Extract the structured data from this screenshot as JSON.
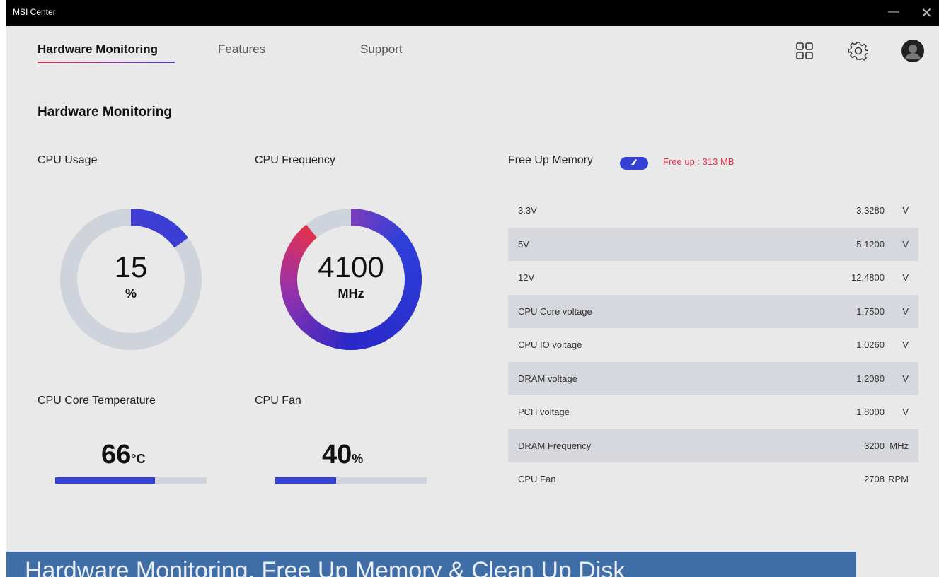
{
  "window": {
    "title": "MSI Center",
    "minimize_icon": "minimize-icon",
    "close_icon": "close-icon"
  },
  "nav": {
    "tabs": [
      {
        "label": "Hardware Monitoring",
        "active": true
      },
      {
        "label": "Features",
        "active": false
      },
      {
        "label": "Support",
        "active": false
      }
    ],
    "icons": [
      "grid-apps-icon",
      "gear-icon",
      "user-avatar-icon"
    ]
  },
  "page": {
    "title": "Hardware Monitoring"
  },
  "cpu_usage": {
    "label": "CPU Usage",
    "value": "15",
    "unit": "%",
    "fraction": 0.15
  },
  "cpu_frequency": {
    "label": "CPU Frequency",
    "value": "4100",
    "unit": "MHz",
    "fraction": 0.89
  },
  "cpu_temp": {
    "label": "CPU Core Temperature",
    "value": "66",
    "unit": "°C",
    "fraction": 0.66
  },
  "cpu_fan": {
    "label": "CPU Fan",
    "value": "40",
    "unit": "%",
    "fraction": 0.4
  },
  "free_memory": {
    "label": "Free Up Memory",
    "button_icon": "rocket-icon",
    "status": "Free up : 313 MB"
  },
  "voltages": [
    {
      "name": "3.3V",
      "value": "3.3280",
      "unit": "V"
    },
    {
      "name": "5V",
      "value": "5.1200",
      "unit": "V"
    },
    {
      "name": "12V",
      "value": "12.4800",
      "unit": "V"
    },
    {
      "name": "CPU Core voltage",
      "value": "1.7500",
      "unit": "V"
    },
    {
      "name": "CPU IO voltage",
      "value": "1.0260",
      "unit": "V"
    },
    {
      "name": "DRAM voltage",
      "value": "1.2080",
      "unit": "V"
    },
    {
      "name": "PCH voltage",
      "value": "1.8000",
      "unit": "V"
    },
    {
      "name": "DRAM Frequency",
      "value": "3200",
      "unit": "MHz"
    },
    {
      "name": "CPU Fan",
      "value": "2708",
      "unit": "RPM"
    }
  ],
  "banner": {
    "text": "Hardware Monitoring, Free Up Memory & Clean Up Disk"
  },
  "colors": {
    "accent_blue": "#3441d4",
    "accent_red": "#e8304a",
    "track": "#cfd3db"
  }
}
